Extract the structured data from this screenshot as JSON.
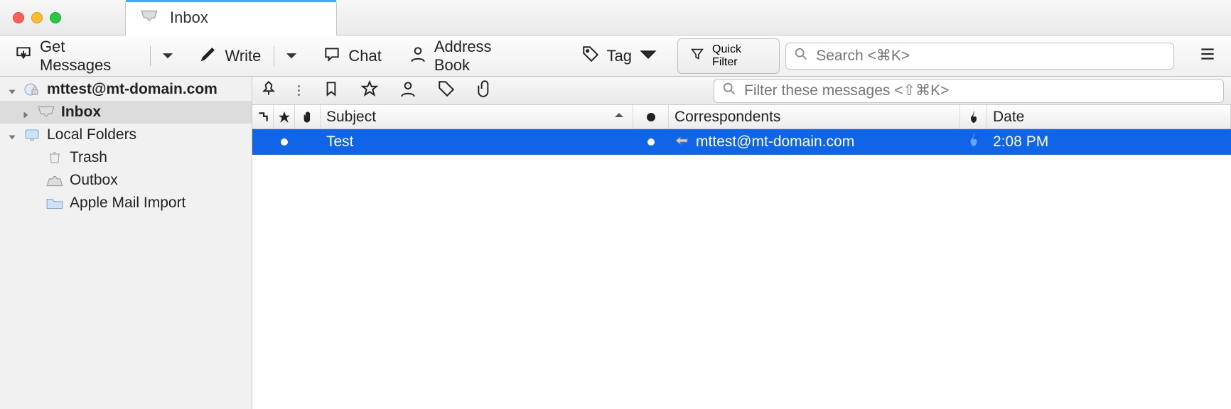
{
  "tab": {
    "label": "Inbox"
  },
  "toolbar": {
    "get_messages": "Get Messages",
    "write": "Write",
    "chat": "Chat",
    "address_book": "Address Book",
    "tag": "Tag",
    "quick_filter": "Quick Filter",
    "search_placeholder": "Search <⌘K>"
  },
  "sidebar": {
    "account": "mttest@mt-domain.com",
    "inbox": "Inbox",
    "local_folders": "Local Folders",
    "trash": "Trash",
    "outbox": "Outbox",
    "apple_import": "Apple Mail Import"
  },
  "filterbar": {
    "placeholder": "Filter these messages <⇧⌘K>"
  },
  "columns": {
    "subject": "Subject",
    "correspondents": "Correspondents",
    "date": "Date"
  },
  "messages": [
    {
      "subject": "Test",
      "correspondent": "mttest@mt-domain.com",
      "date": "2:08 PM"
    }
  ]
}
